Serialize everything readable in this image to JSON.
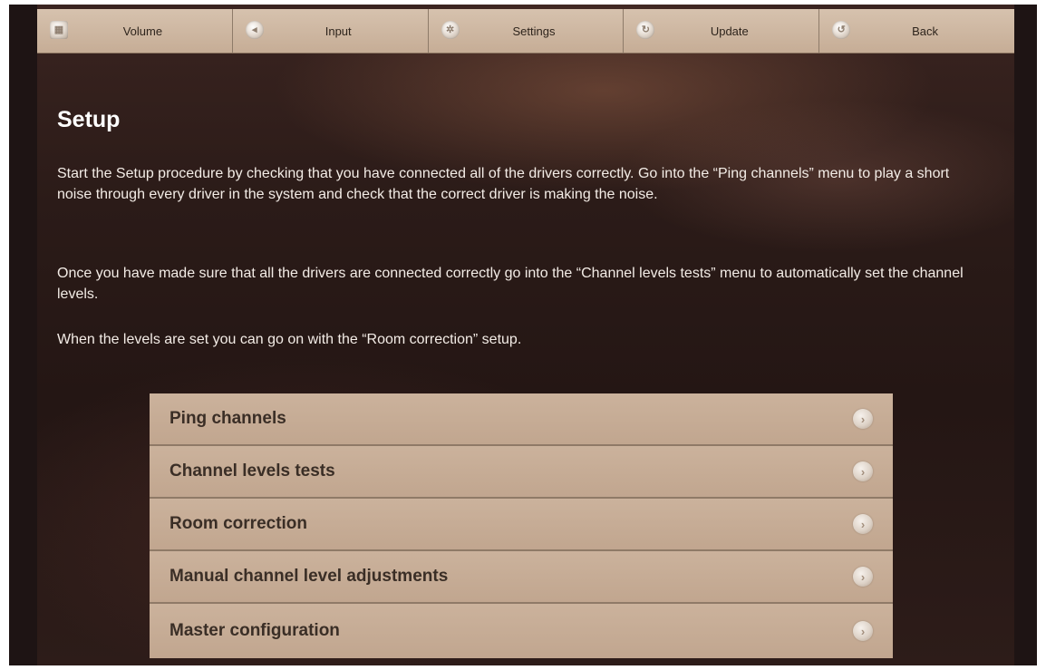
{
  "nav": [
    {
      "label": "Volume",
      "icon": "grid-icon"
    },
    {
      "label": "Input",
      "icon": "speaker-icon"
    },
    {
      "label": "Settings",
      "icon": "gear-icon"
    },
    {
      "label": "Update",
      "icon": "refresh-icon"
    },
    {
      "label": "Back",
      "icon": "back-arrow-icon"
    }
  ],
  "page": {
    "title": "Setup",
    "paragraphs": [
      "Start the Setup procedure by checking that you have connected all of the drivers correctly. Go into the “Ping channels” menu to play a short noise through every driver in the system and check that the correct driver is making the noise.",
      "Once you have made sure that all the drivers are connected correctly go into the “Channel levels tests” menu to automatically set the channel levels.",
      "When the levels are set you can go on with the “Room correction” setup."
    ]
  },
  "menu": [
    {
      "label": "Ping channels"
    },
    {
      "label": "Channel levels tests"
    },
    {
      "label": "Room correction"
    },
    {
      "label": "Manual channel level adjustments"
    },
    {
      "label": "Master configuration"
    }
  ],
  "icons": {
    "menu_arrow": "chevron-right-icon"
  }
}
